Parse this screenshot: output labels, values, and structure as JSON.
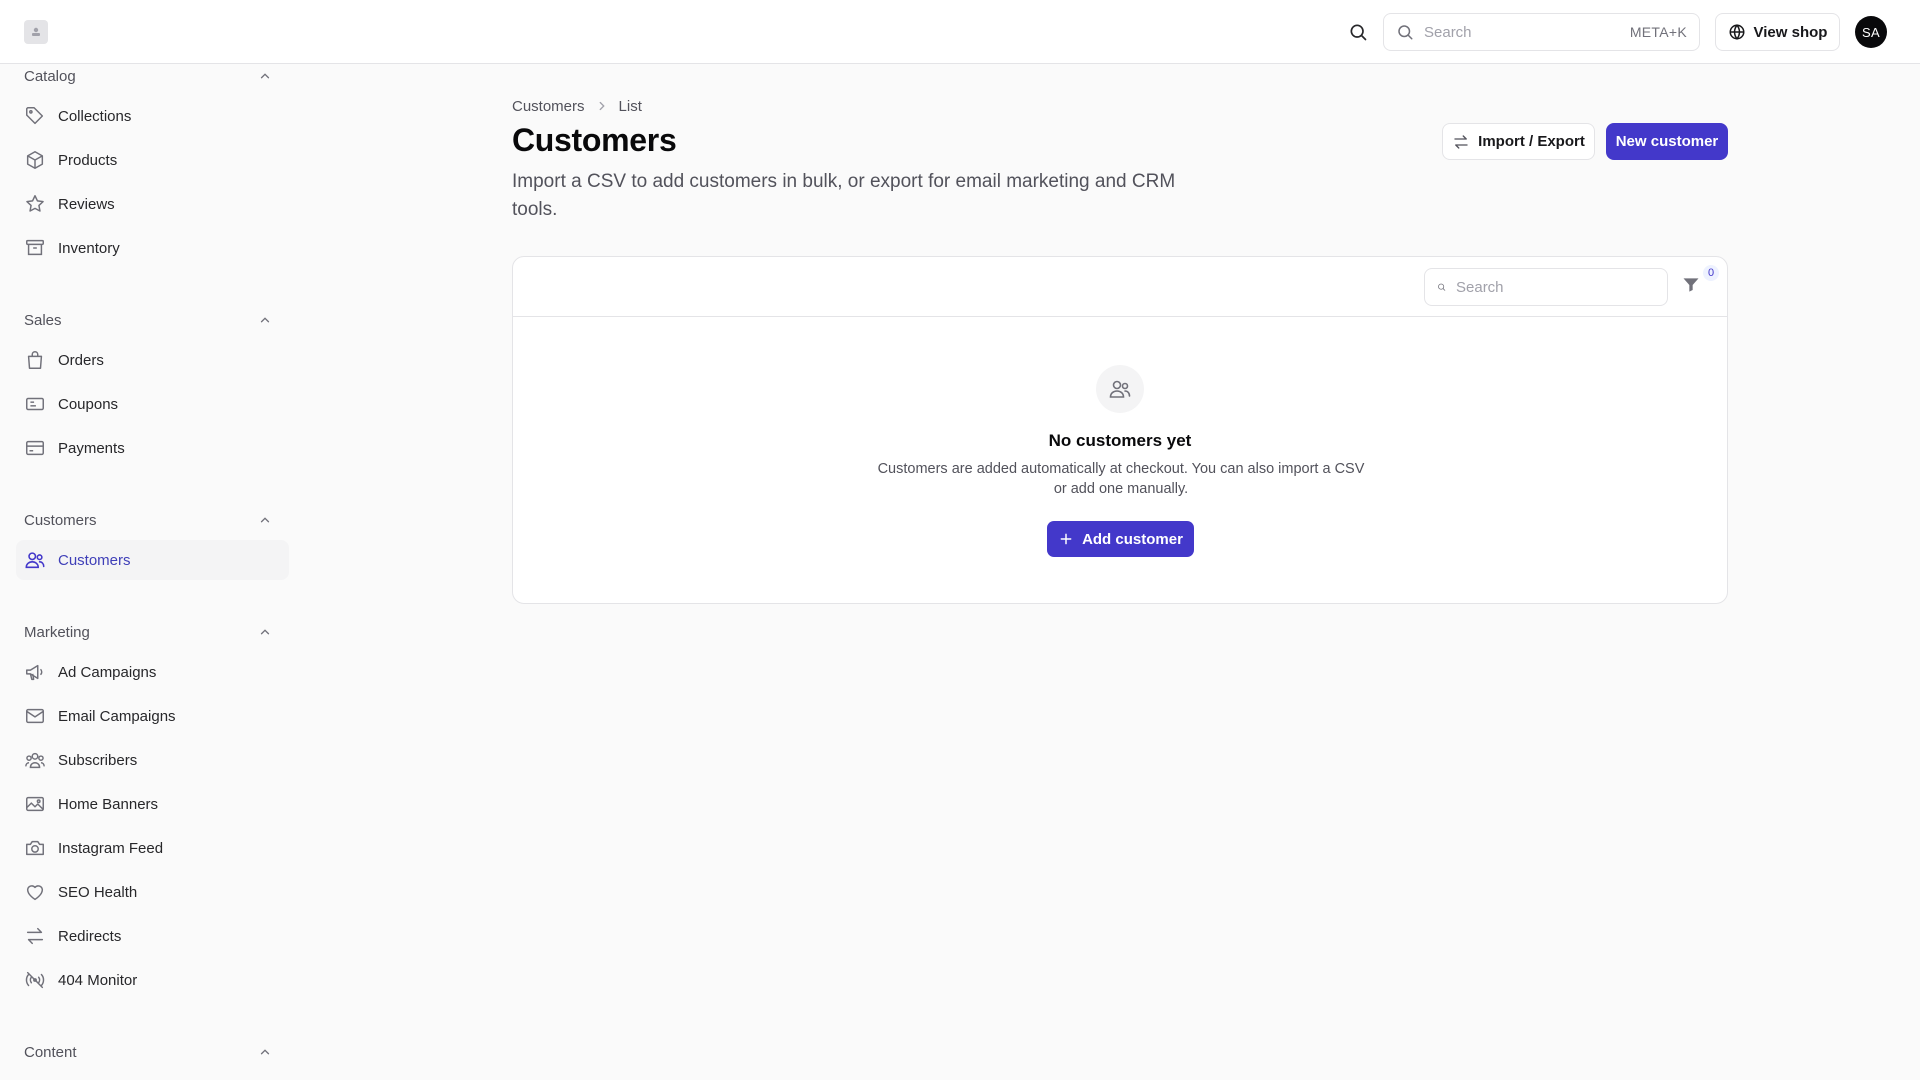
{
  "topbar": {
    "search_placeholder": "Search",
    "search_shortcut": "META+K",
    "view_shop_label": "View shop",
    "avatar_initials": "SA"
  },
  "sidebar": {
    "sections": [
      {
        "title": "Catalog",
        "items": [
          {
            "label": "Collections",
            "icon": "tag-icon"
          },
          {
            "label": "Products",
            "icon": "box-icon"
          },
          {
            "label": "Reviews",
            "icon": "star-icon"
          },
          {
            "label": "Inventory",
            "icon": "archive-icon"
          }
        ]
      },
      {
        "title": "Sales",
        "items": [
          {
            "label": "Orders",
            "icon": "shopping-bag-icon"
          },
          {
            "label": "Coupons",
            "icon": "ticket-icon"
          },
          {
            "label": "Payments",
            "icon": "credit-card-icon"
          }
        ]
      },
      {
        "title": "Customers",
        "items": [
          {
            "label": "Customers",
            "icon": "users-icon",
            "active": true
          }
        ]
      },
      {
        "title": "Marketing",
        "items": [
          {
            "label": "Ad Campaigns",
            "icon": "megaphone-icon"
          },
          {
            "label": "Email Campaigns",
            "icon": "mail-icon"
          },
          {
            "label": "Subscribers",
            "icon": "subscribers-icon"
          },
          {
            "label": "Home Banners",
            "icon": "image-icon"
          },
          {
            "label": "Instagram Feed",
            "icon": "camera-icon"
          },
          {
            "label": "SEO Health",
            "icon": "heart-icon"
          },
          {
            "label": "Redirects",
            "icon": "arrows-icon"
          },
          {
            "label": "404 Monitor",
            "icon": "signal-off-icon"
          }
        ]
      },
      {
        "title": "Content",
        "items": []
      }
    ]
  },
  "main": {
    "breadcrumb": [
      "Customers",
      "List"
    ],
    "title": "Customers",
    "description": "Import a CSV to add customers in bulk, or export for email marketing and CRM tools.",
    "import_export_label": "Import / Export",
    "new_customer_label": "New customer",
    "table": {
      "search_placeholder": "Search",
      "filter_count": "0",
      "empty_title": "No customers yet",
      "empty_description": "Customers are added automatically at checkout. You can also import a CSV or add one manually.",
      "add_button_label": "Add customer"
    }
  },
  "colors": {
    "accent": "#4338ca",
    "active_text": "#3f3fb8",
    "border": "#e4e4e7"
  }
}
